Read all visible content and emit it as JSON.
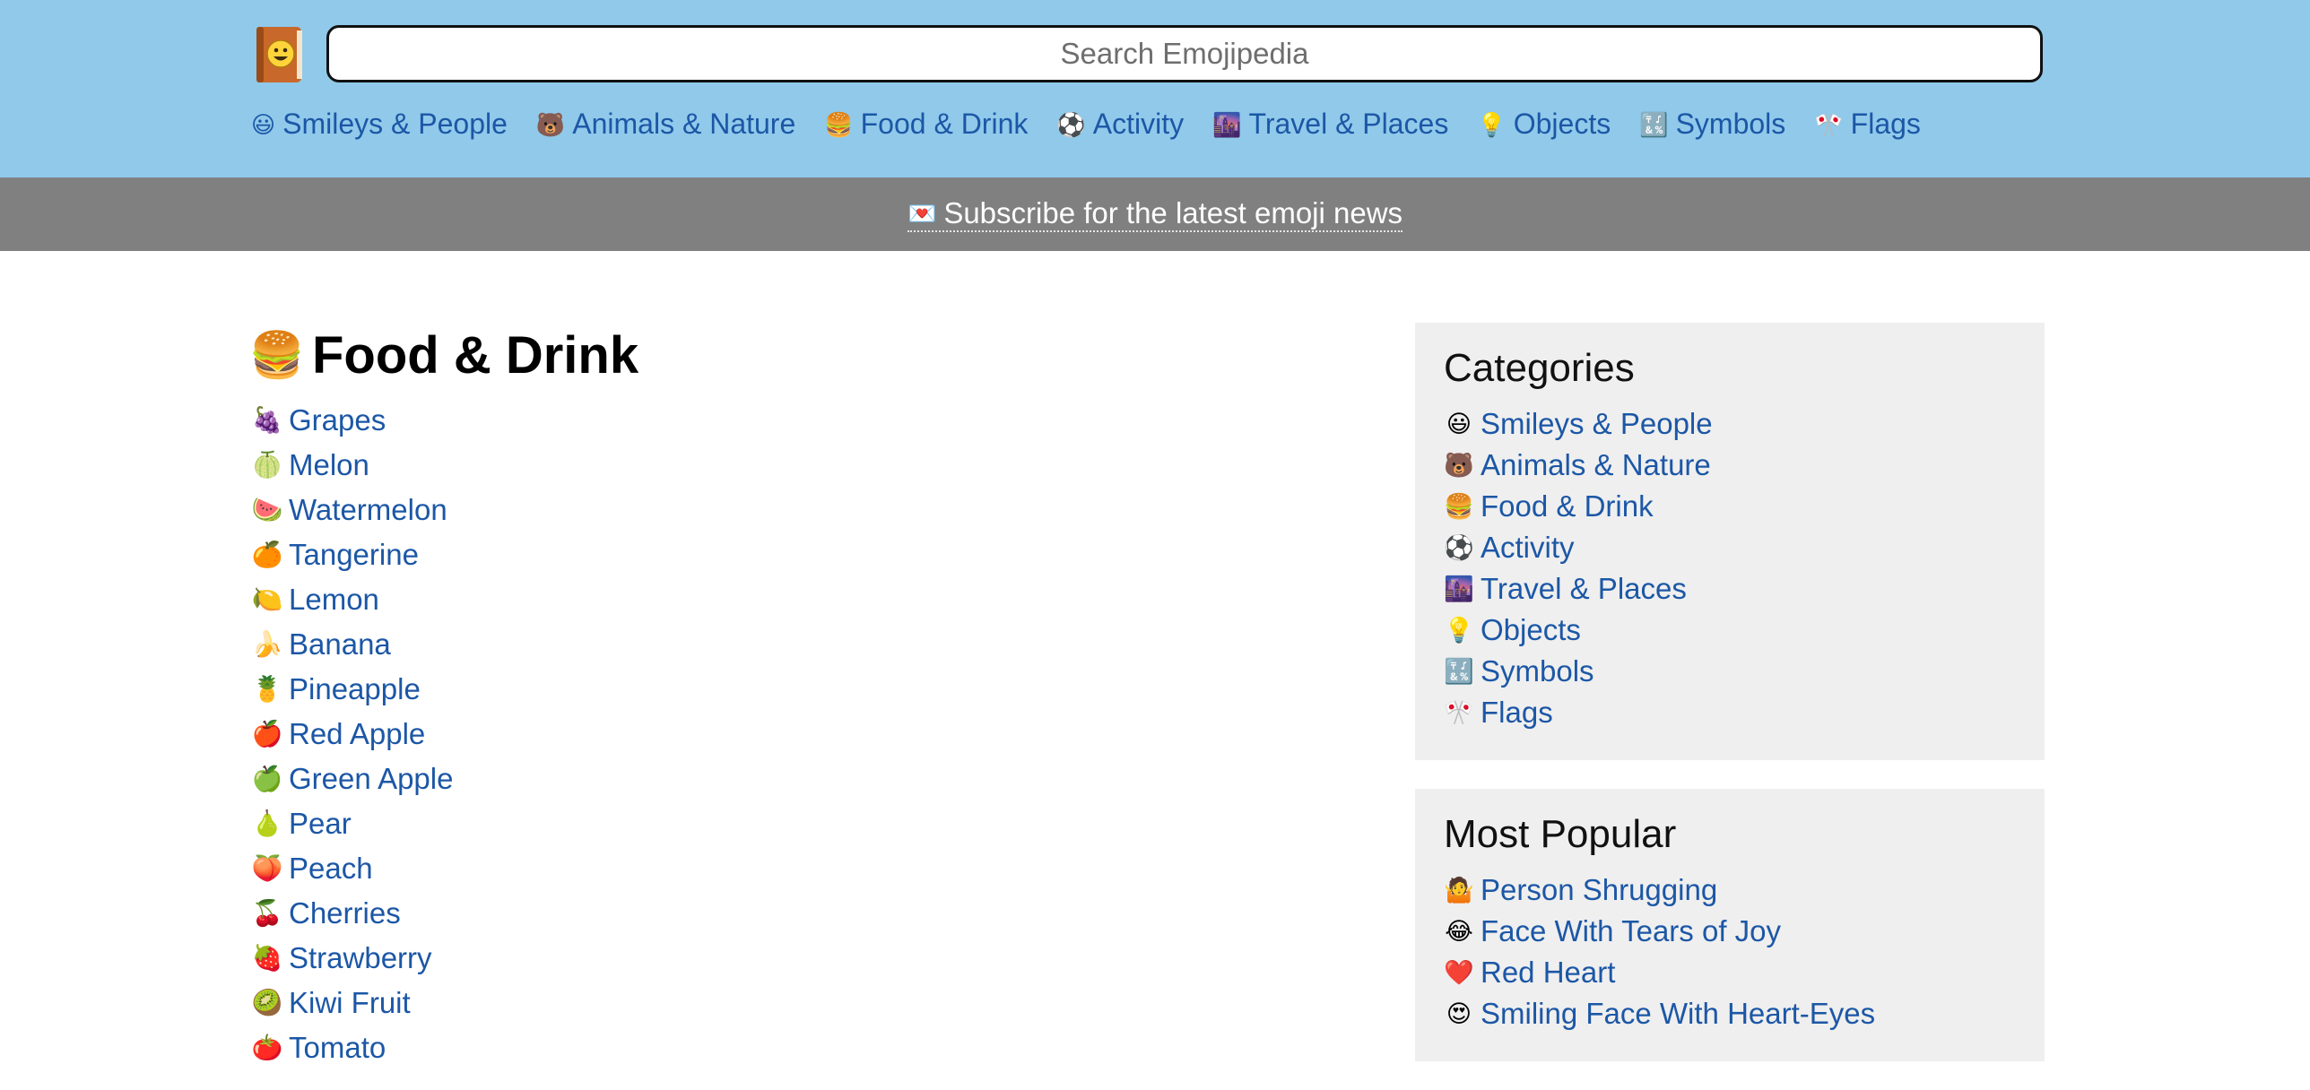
{
  "header": {
    "logo_icon": "emojipedia-book-logo",
    "search_placeholder": "Search Emojipedia",
    "nav": [
      {
        "label": "Smileys & People",
        "icon": "grinning-face-icon",
        "emoji": "😃"
      },
      {
        "label": "Animals & Nature",
        "icon": "bear-icon",
        "emoji": "🐻"
      },
      {
        "label": "Food & Drink",
        "icon": "hamburger-icon",
        "emoji": "🍔"
      },
      {
        "label": "Activity",
        "icon": "soccer-ball-icon",
        "emoji": "⚽"
      },
      {
        "label": "Travel & Places",
        "icon": "cityscape-icon",
        "emoji": "🌆"
      },
      {
        "label": "Objects",
        "icon": "light-bulb-icon",
        "emoji": "💡"
      },
      {
        "label": "Symbols",
        "icon": "symbols-icon",
        "emoji": "🔣"
      },
      {
        "label": "Flags",
        "icon": "flags-icon",
        "emoji": "🎌"
      }
    ]
  },
  "subscribe": {
    "label": "Subscribe for the latest emoji news",
    "icon": "love-letter-icon",
    "emoji": "💌"
  },
  "main": {
    "title": "Food & Drink",
    "title_emoji": "🍔",
    "items": [
      {
        "label": "Grapes",
        "emoji": "🍇"
      },
      {
        "label": "Melon",
        "emoji": "🍈"
      },
      {
        "label": "Watermelon",
        "emoji": "🍉"
      },
      {
        "label": "Tangerine",
        "emoji": "🍊"
      },
      {
        "label": "Lemon",
        "emoji": "🍋"
      },
      {
        "label": "Banana",
        "emoji": "🍌"
      },
      {
        "label": "Pineapple",
        "emoji": "🍍"
      },
      {
        "label": "Red Apple",
        "emoji": "🍎"
      },
      {
        "label": "Green Apple",
        "emoji": "🍏"
      },
      {
        "label": "Pear",
        "emoji": "🍐"
      },
      {
        "label": "Peach",
        "emoji": "🍑"
      },
      {
        "label": "Cherries",
        "emoji": "🍒"
      },
      {
        "label": "Strawberry",
        "emoji": "🍓"
      },
      {
        "label": "Kiwi Fruit",
        "emoji": "🥝"
      },
      {
        "label": "Tomato",
        "emoji": "🍅"
      }
    ]
  },
  "sidebar": {
    "categories_title": "Categories",
    "categories": [
      {
        "label": "Smileys & People",
        "emoji": "😃"
      },
      {
        "label": "Animals & Nature",
        "emoji": "🐻"
      },
      {
        "label": "Food & Drink",
        "emoji": "🍔"
      },
      {
        "label": "Activity",
        "emoji": "⚽"
      },
      {
        "label": "Travel & Places",
        "emoji": "🌆"
      },
      {
        "label": "Objects",
        "emoji": "💡"
      },
      {
        "label": "Symbols",
        "emoji": "🔣"
      },
      {
        "label": "Flags",
        "emoji": "🎌"
      }
    ],
    "popular_title": "Most Popular",
    "popular": [
      {
        "label": "Person Shrugging",
        "emoji": "🤷"
      },
      {
        "label": "Face With Tears of Joy",
        "emoji": "😂"
      },
      {
        "label": "Red Heart",
        "emoji": "❤️"
      },
      {
        "label": "Smiling Face With Heart-Eyes",
        "emoji": "😍"
      }
    ]
  },
  "colors": {
    "header_bg": "#90c9ea",
    "subbar_bg": "#808080",
    "link": "#1c57a6",
    "panel_bg": "#efefef"
  }
}
